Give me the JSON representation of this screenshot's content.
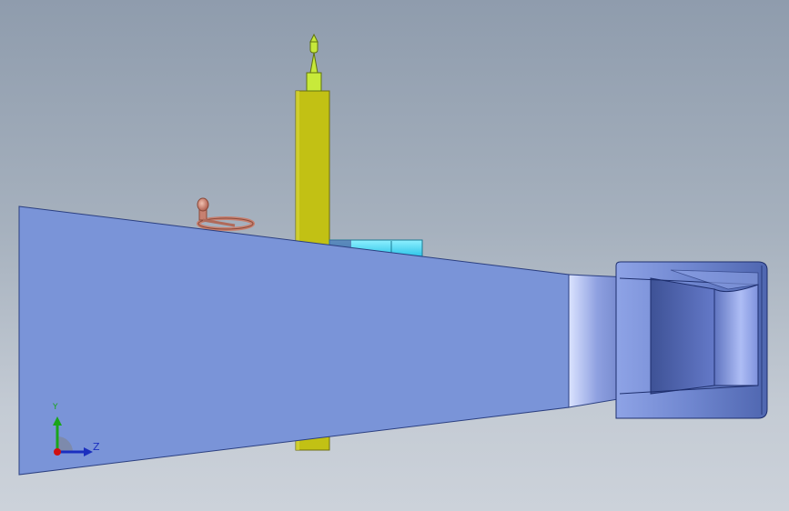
{
  "viewport": {
    "background_top": "#8f9cad",
    "background_bottom": "#ccd2da"
  },
  "model": {
    "parts": [
      {
        "name": "tapered-plate",
        "color": "#7a94d8"
      },
      {
        "name": "vertical-column",
        "color": "#c2c114"
      },
      {
        "name": "column-top-cap",
        "color": "#c8ea3a"
      },
      {
        "name": "handwheel",
        "color": "#c78070"
      },
      {
        "name": "cyan-bracket",
        "color": "#3fd2f0"
      },
      {
        "name": "end-housing",
        "color": "#6f86cf"
      }
    ]
  },
  "triad": {
    "y_label": "Y",
    "z_label": "Z",
    "y_color": "#1aa51a",
    "z_color": "#1b2fbf",
    "x_color": "#d01010"
  }
}
